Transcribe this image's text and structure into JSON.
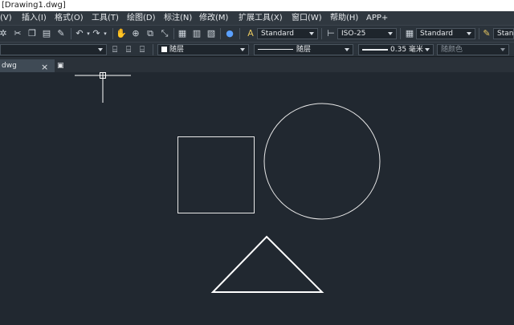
{
  "window": {
    "title": "[Drawing1.dwg]"
  },
  "menu": [
    "(V)",
    "插入(I)",
    "格式(O)",
    "工具(T)",
    "绘图(D)",
    "标注(N)",
    "修改(M)",
    "扩展工具(X)",
    "窗口(W)",
    "帮助(H)",
    "APP+"
  ],
  "toolbar": {
    "text_style": "Standard",
    "dim_style": "ISO-25",
    "table_style": "Standard",
    "multileader_style": "Standa",
    "layer_color": "随层",
    "linetype": "随层",
    "lineweight": "0.35 毫米",
    "plot_style": "随颜色"
  },
  "tabs": {
    "document": "dwg"
  },
  "icons": {
    "tab_close": "×",
    "new_tab": "▣"
  }
}
